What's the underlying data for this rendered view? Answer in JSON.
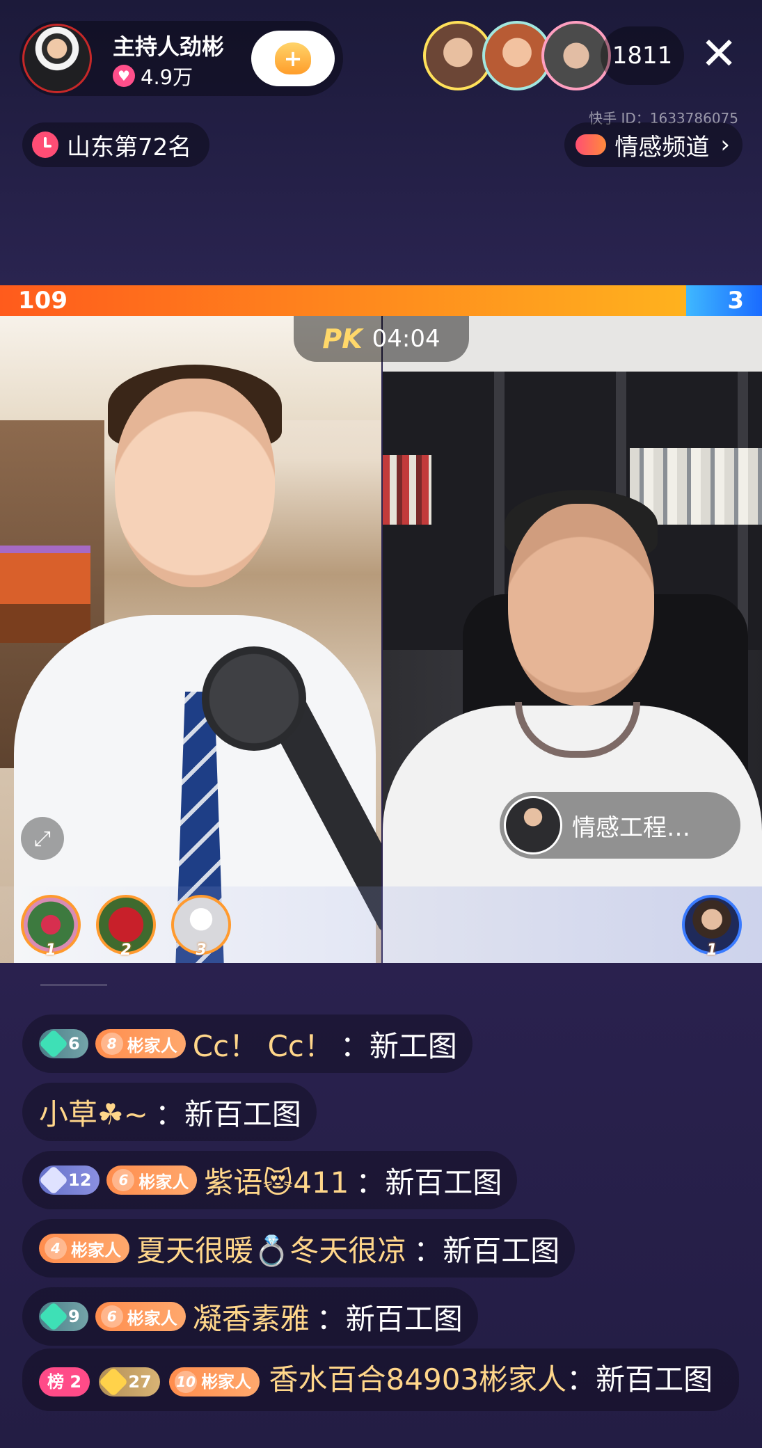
{
  "host": {
    "name": "主持人劲彬",
    "likes": "4.9万",
    "follow_symbol": "+"
  },
  "viewers": {
    "count": "1811"
  },
  "close_symbol": "✕",
  "platform_id": "快手 ID：1633786075",
  "rank_label": "山东第72名",
  "channel_label": "情感频道",
  "channel_chevron": "›",
  "pk": {
    "logo_p": "P",
    "logo_k": "K",
    "timer": "04:04",
    "score_left": "109",
    "score_right": "3",
    "left_share": 0.9
  },
  "guest_tag": "情感工程…",
  "contributors_left": [
    "1",
    "2",
    "3"
  ],
  "contributors_right": [
    "1"
  ],
  "chat": [
    {
      "badges": [
        {
          "type": "level",
          "value": "6"
        },
        {
          "type": "fan",
          "value": "8",
          "label": "彬家人"
        }
      ],
      "nick": "Cc！ Cc！",
      "sep": "：",
      "msg": "新工图"
    },
    {
      "badges": [],
      "nick": "小草☘~",
      "sep": "：",
      "msg": "新百工图"
    },
    {
      "badges": [
        {
          "type": "level",
          "value": "12"
        },
        {
          "type": "fan",
          "value": "6",
          "label": "彬家人"
        }
      ],
      "nick": "紫语😻411",
      "sep": "：",
      "msg": "新百工图"
    },
    {
      "badges": [
        {
          "type": "fan",
          "value": "4",
          "label": "彬家人"
        }
      ],
      "nick": "夏天很暖💍冬天很凉",
      "sep": "：",
      "msg": "新百工图"
    },
    {
      "badges": [
        {
          "type": "level",
          "value": "9"
        },
        {
          "type": "fan",
          "value": "6",
          "label": "彬家人"
        }
      ],
      "nick": "凝香素雅",
      "sep": "：",
      "msg": "新百工图"
    },
    {
      "badges": [
        {
          "type": "rank",
          "label": "榜",
          "value": "2"
        },
        {
          "type": "level",
          "value": "27"
        },
        {
          "type": "fan",
          "value": "10",
          "label": "彬家人"
        }
      ],
      "nick": "香水百合84903彬家人",
      "sep": "：",
      "msg": "新百工图"
    }
  ]
}
